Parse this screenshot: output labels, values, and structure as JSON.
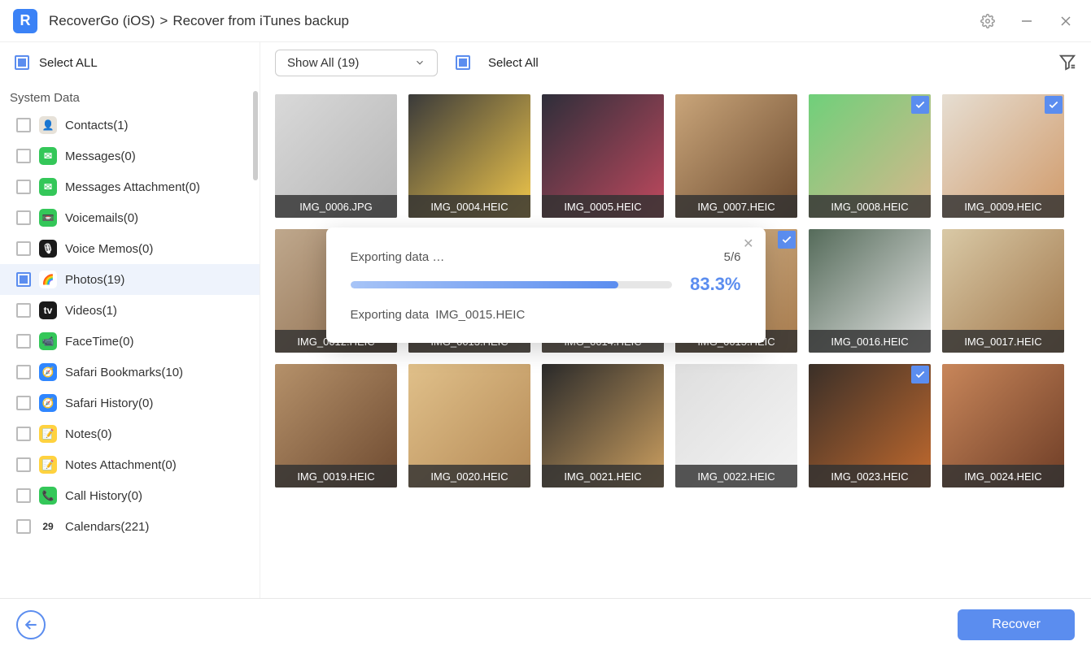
{
  "titlebar": {
    "app_abbrev": "R",
    "crumb1": "RecoverGo (iOS)",
    "crumb_sep": ">",
    "crumb2": "Recover from iTunes backup"
  },
  "toolbar": {
    "select_all_sidebar": "Select ALL",
    "dropdown_label": "Show All (19)",
    "select_all_main": "Select All"
  },
  "sidebar": {
    "section": "System Data",
    "items": [
      {
        "label": "Contacts(1)",
        "active": false,
        "checked": false,
        "icon_bg": "#e7e2d9",
        "icon_txt": "👤"
      },
      {
        "label": "Messages(0)",
        "active": false,
        "checked": false,
        "icon_bg": "#34c759",
        "icon_txt": "✉"
      },
      {
        "label": "Messages Attachment(0)",
        "active": false,
        "checked": false,
        "icon_bg": "#34c759",
        "icon_txt": "✉"
      },
      {
        "label": "Voicemails(0)",
        "active": false,
        "checked": false,
        "icon_bg": "#34c759",
        "icon_txt": "📼"
      },
      {
        "label": "Voice Memos(0)",
        "active": false,
        "checked": false,
        "icon_bg": "#1a1a1a",
        "icon_txt": "🎙"
      },
      {
        "label": "Photos(19)",
        "active": true,
        "checked": true,
        "icon_bg": "#ffffff",
        "icon_txt": "🌈"
      },
      {
        "label": "Videos(1)",
        "active": false,
        "checked": false,
        "icon_bg": "#1a1a1a",
        "icon_txt": "tv"
      },
      {
        "label": "FaceTime(0)",
        "active": false,
        "checked": false,
        "icon_bg": "#34c759",
        "icon_txt": "📹"
      },
      {
        "label": "Safari Bookmarks(10)",
        "active": false,
        "checked": false,
        "icon_bg": "#2f86ff",
        "icon_txt": "🧭"
      },
      {
        "label": "Safari History(0)",
        "active": false,
        "checked": false,
        "icon_bg": "#2f86ff",
        "icon_txt": "🧭"
      },
      {
        "label": "Notes(0)",
        "active": false,
        "checked": false,
        "icon_bg": "#ffd23f",
        "icon_txt": "📝"
      },
      {
        "label": "Notes Attachment(0)",
        "active": false,
        "checked": false,
        "icon_bg": "#ffd23f",
        "icon_txt": "📝"
      },
      {
        "label": "Call History(0)",
        "active": false,
        "checked": false,
        "icon_bg": "#34c759",
        "icon_txt": "📞"
      },
      {
        "label": "Calendars(221)",
        "active": false,
        "checked": false,
        "icon_bg": "#ffffff",
        "icon_txt": "29"
      }
    ]
  },
  "grid": [
    {
      "name": "IMG_0006.JPG",
      "checked": false,
      "c1": "#d9d9d9",
      "c2": "#b5b5b5"
    },
    {
      "name": "IMG_0004.HEIC",
      "checked": false,
      "c1": "#3a3a3a",
      "c2": "#f2c84b"
    },
    {
      "name": "IMG_0005.HEIC",
      "checked": false,
      "c1": "#2e2e3a",
      "c2": "#c0495e"
    },
    {
      "name": "IMG_0007.HEIC",
      "checked": false,
      "c1": "#c9a57a",
      "c2": "#6c4a2e"
    },
    {
      "name": "IMG_0008.HEIC",
      "checked": true,
      "c1": "#6fd07a",
      "c2": "#d9b68c"
    },
    {
      "name": "IMG_0009.HEIC",
      "checked": true,
      "c1": "#e6ded2",
      "c2": "#d09a6a"
    },
    {
      "name": "IMG_0012.HEIC",
      "checked": false,
      "c1": "#bfa88d",
      "c2": "#8c6a4a"
    },
    {
      "name": "IMG_0013.HEIC",
      "checked": false,
      "c1": "#8c6a4a",
      "c2": "#bfa88d"
    },
    {
      "name": "IMG_0014.HEIC",
      "checked": true,
      "c1": "#a87c52",
      "c2": "#e0cdb6"
    },
    {
      "name": "IMG_0015.HEIC",
      "checked": true,
      "c1": "#d6b890",
      "c2": "#a67a4c"
    },
    {
      "name": "IMG_0016.HEIC",
      "checked": false,
      "c1": "#556b5a",
      "c2": "#e8e8e8"
    },
    {
      "name": "IMG_0017.HEIC",
      "checked": false,
      "c1": "#d9c9a6",
      "c2": "#a0764a"
    },
    {
      "name": "IMG_0019.HEIC",
      "checked": false,
      "c1": "#b5916a",
      "c2": "#6e4a30"
    },
    {
      "name": "IMG_0020.HEIC",
      "checked": false,
      "c1": "#e0c08a",
      "c2": "#b58a56"
    },
    {
      "name": "IMG_0021.HEIC",
      "checked": false,
      "c1": "#2a2a2a",
      "c2": "#cda060"
    },
    {
      "name": "IMG_0022.HEIC",
      "checked": false,
      "c1": "#dedede",
      "c2": "#f4f4f4"
    },
    {
      "name": "IMG_0023.HEIC",
      "checked": true,
      "c1": "#3a2f28",
      "c2": "#c26a2e"
    },
    {
      "name": "IMG_0024.HEIC",
      "checked": false,
      "c1": "#c8865a",
      "c2": "#6e3d26"
    }
  ],
  "modal": {
    "title": "Exporting data …",
    "count": "5/6",
    "percent": "83.3%",
    "percent_num": 83.3,
    "line2_prefix": "Exporting data",
    "line2_file": "IMG_0015.HEIC"
  },
  "footer": {
    "recover": "Recover"
  }
}
